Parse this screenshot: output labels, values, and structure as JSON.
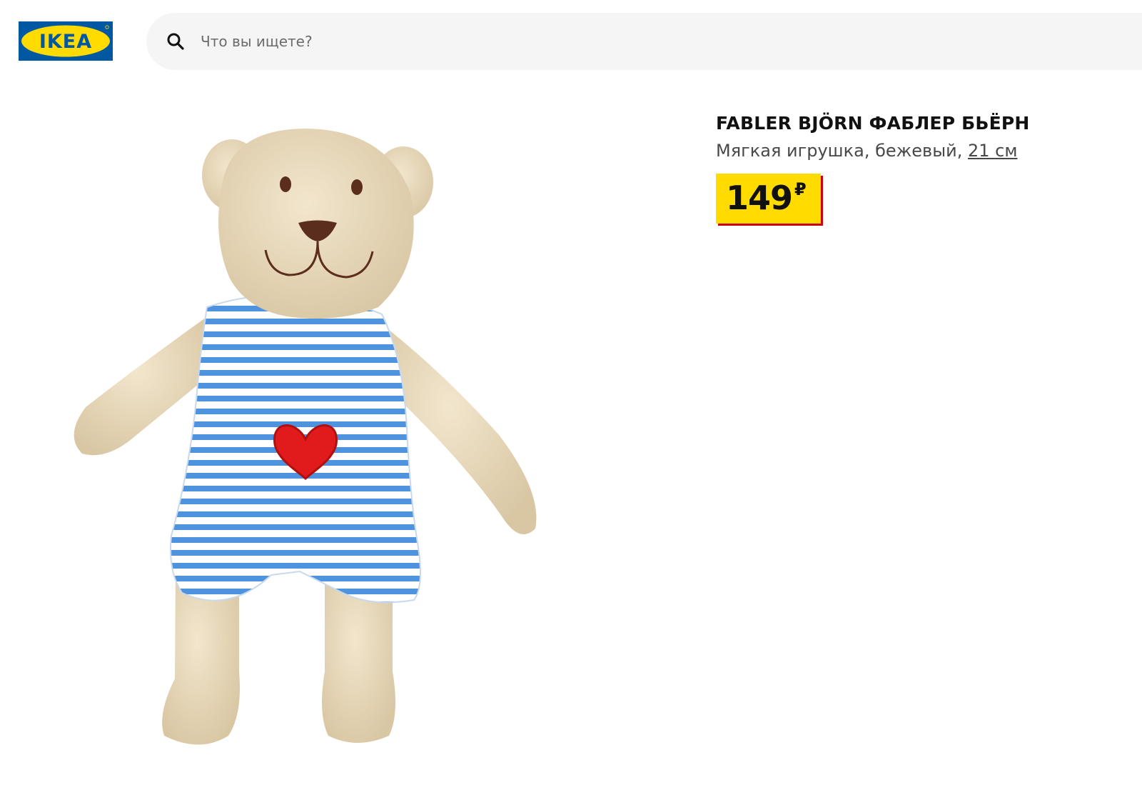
{
  "header": {
    "logo_text": "IKEA",
    "search": {
      "placeholder": "Что вы ищете?",
      "value": ""
    }
  },
  "product": {
    "name": "FABLER BJÖRN ФАБЛЕР БЬЁРН",
    "description": "Мягкая игрушка, бежевый,",
    "size": "21 см",
    "price": {
      "value": "149",
      "currency": "₽"
    }
  },
  "colors": {
    "brand_blue": "#0058a3",
    "brand_yellow": "#ffdb00",
    "price_shadow_red": "#cc0008",
    "search_bg": "#f5f5f5"
  },
  "icons": [
    "search-icon"
  ]
}
